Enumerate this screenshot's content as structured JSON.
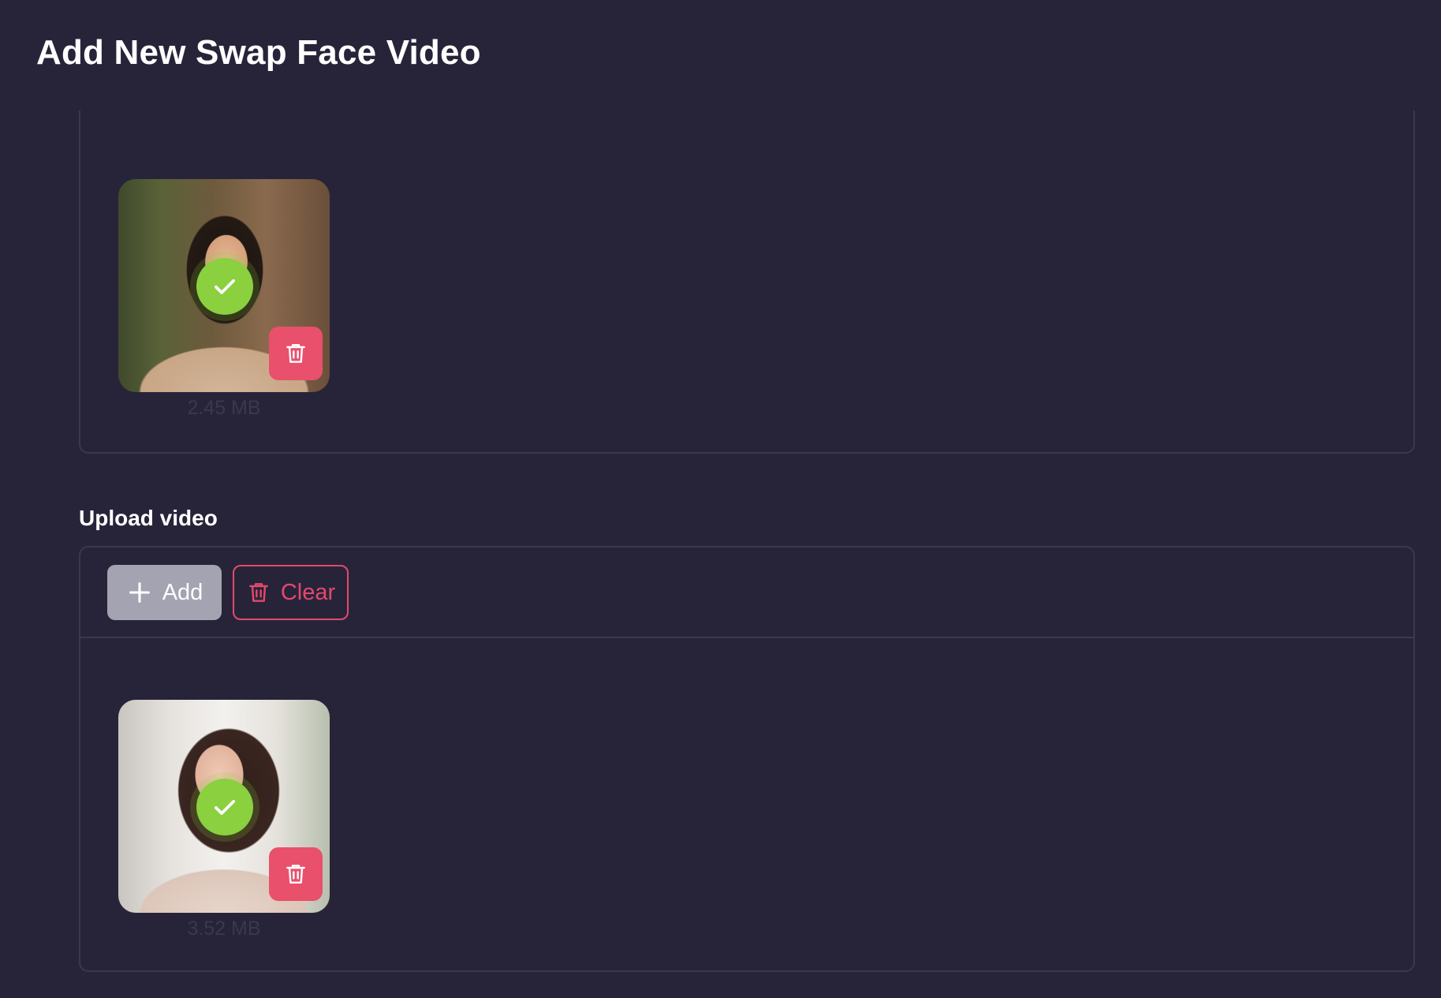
{
  "page": {
    "title": "Add New Swap Face Video"
  },
  "face_panel": {
    "image": {
      "alt": "Uploaded face photo",
      "file_size": "2.45 MB",
      "status": "selected"
    }
  },
  "video_section": {
    "label": "Upload video",
    "toolbar": {
      "add_label": "Add",
      "clear_label": "Clear"
    },
    "video": {
      "alt": "Uploaded video thumbnail",
      "file_size": "3.52 MB",
      "status": "selected"
    }
  },
  "colors": {
    "background": "#27243a",
    "border": "#3a3752",
    "accent_danger": "#e9506c",
    "accent_success": "#8ad03f",
    "button_neutral": "#a4a3b1"
  },
  "icons": {
    "check": "check-icon",
    "trash": "trash-icon",
    "plus": "plus-icon"
  }
}
